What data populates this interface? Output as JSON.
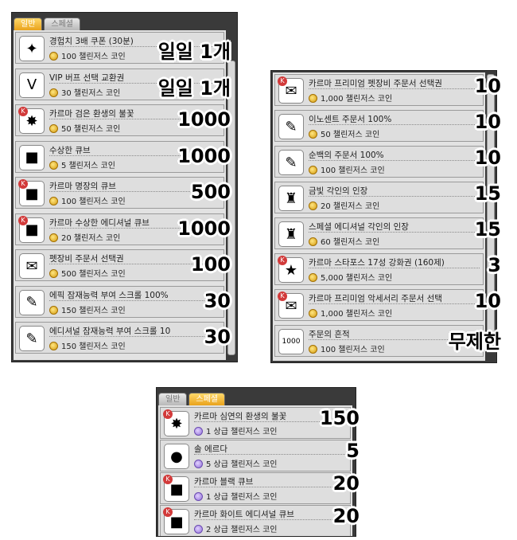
{
  "panel_general": {
    "tabs": [
      "일반",
      "스페셜"
    ],
    "items": [
      {
        "name": "경험치 3배 쿠폰 (30분)",
        "price": "100 챌린저스 코인",
        "limit": "일일 1개",
        "icon": "exp-coupon-icon",
        "glyph": "✦"
      },
      {
        "name": "VIP 버프 선택 교환권",
        "price": "30 챌린저스 코인",
        "limit": "일일 1개",
        "icon": "vip-ticket-icon",
        "glyph": "V"
      },
      {
        "name": "카르마 검은 환생의 불꽃",
        "price": "50 챌린저스 코인",
        "limit": "1000",
        "icon": "black-rebirth-flame-icon",
        "glyph": "✸"
      },
      {
        "name": "수상한 큐브",
        "price": "5 챌린저스 코인",
        "limit": "1000",
        "icon": "suspicious-cube-icon",
        "glyph": "■"
      },
      {
        "name": "카르마 명장의 큐브",
        "price": "100 챌린저스 코인",
        "limit": "500",
        "icon": "master-cube-icon",
        "glyph": "■"
      },
      {
        "name": "카르마 수상한 에디셔널 큐브",
        "price": "20 챌린저스 코인",
        "limit": "1000",
        "icon": "additional-cube-icon",
        "glyph": "■"
      },
      {
        "name": "펫장비 주문서 선택권",
        "price": "500 챌린저스 코인",
        "limit": "100",
        "icon": "pet-scroll-ticket-icon",
        "glyph": "✉"
      },
      {
        "name": "에픽 잠재능력 부여 스크롤 100%",
        "price": "150 챌린저스 코인",
        "limit": "30",
        "icon": "epic-potential-scroll-icon",
        "glyph": "✎"
      },
      {
        "name": "에디셔널 잠재능력 부여 스크롤 10",
        "price": "150 챌린저스 코인",
        "limit": "30",
        "icon": "additional-potential-scroll-icon",
        "glyph": "✎"
      }
    ]
  },
  "panel_general_2": {
    "items": [
      {
        "name": "카르마 프리미엄 펫장비 주문서 선택권",
        "price": "1,000 챌린저스 코인",
        "limit": "10",
        "icon": "premium-pet-scroll-ticket-icon",
        "glyph": "✉"
      },
      {
        "name": "이노센트 주문서 100%",
        "price": "50 챌린저스 코인",
        "limit": "10",
        "icon": "innocent-scroll-icon",
        "glyph": "✎"
      },
      {
        "name": "순백의 주문서 100%",
        "price": "100 챌린저스 코인",
        "limit": "10",
        "icon": "clean-slate-scroll-icon",
        "glyph": "✎"
      },
      {
        "name": "금빛 각인의 인장",
        "price": "20 챌린저스 코인",
        "limit": "15",
        "icon": "golden-stamp-icon",
        "glyph": "♜"
      },
      {
        "name": "스페셜 에디셔널 각인의 인장",
        "price": "60 챌린저스 코인",
        "limit": "15",
        "icon": "special-stamp-icon",
        "glyph": "♜"
      },
      {
        "name": "카르마 스타포스 17성 강화권 (160제)",
        "price": "5,000 챌린저스 코인",
        "limit": "3",
        "icon": "starforce-ticket-icon",
        "glyph": "★"
      },
      {
        "name": "카르마 프리미엄 악세서리 주문서 선택",
        "price": "1,000 챌린저스 코인",
        "limit": "10",
        "icon": "premium-accessory-scroll-ticket-icon",
        "glyph": "✉"
      },
      {
        "name": "주문의 흔적",
        "price": "100 챌린저스 코인",
        "limit": "무제한",
        "icon": "spell-trace-icon",
        "glyph": "1000"
      }
    ]
  },
  "panel_special": {
    "tabs": [
      "일반",
      "스페셜"
    ],
    "items": [
      {
        "name": "카르마 심연의 환생의 불꽃",
        "price": "1 상급 챌린저스 코인",
        "limit": "150",
        "icon": "abyss-rebirth-flame-icon",
        "glyph": "✸"
      },
      {
        "name": "솔 에르다",
        "price": "5 상급 챌린저스 코인",
        "limit": "5",
        "icon": "sol-erda-icon",
        "glyph": "●"
      },
      {
        "name": "카르마 블랙 큐브",
        "price": "1 상급 챌린저스 코인",
        "limit": "20",
        "icon": "black-cube-icon",
        "glyph": "■"
      },
      {
        "name": "카르마 화이트 에디셔널 큐브",
        "price": "2 상급 챌린저스 코인",
        "limit": "20",
        "icon": "white-additional-cube-icon",
        "glyph": "■"
      }
    ]
  },
  "colors": {
    "tab_active": "#f0b030",
    "coin_gold": "#e8b020",
    "coin_purple": "#9b7be0"
  }
}
